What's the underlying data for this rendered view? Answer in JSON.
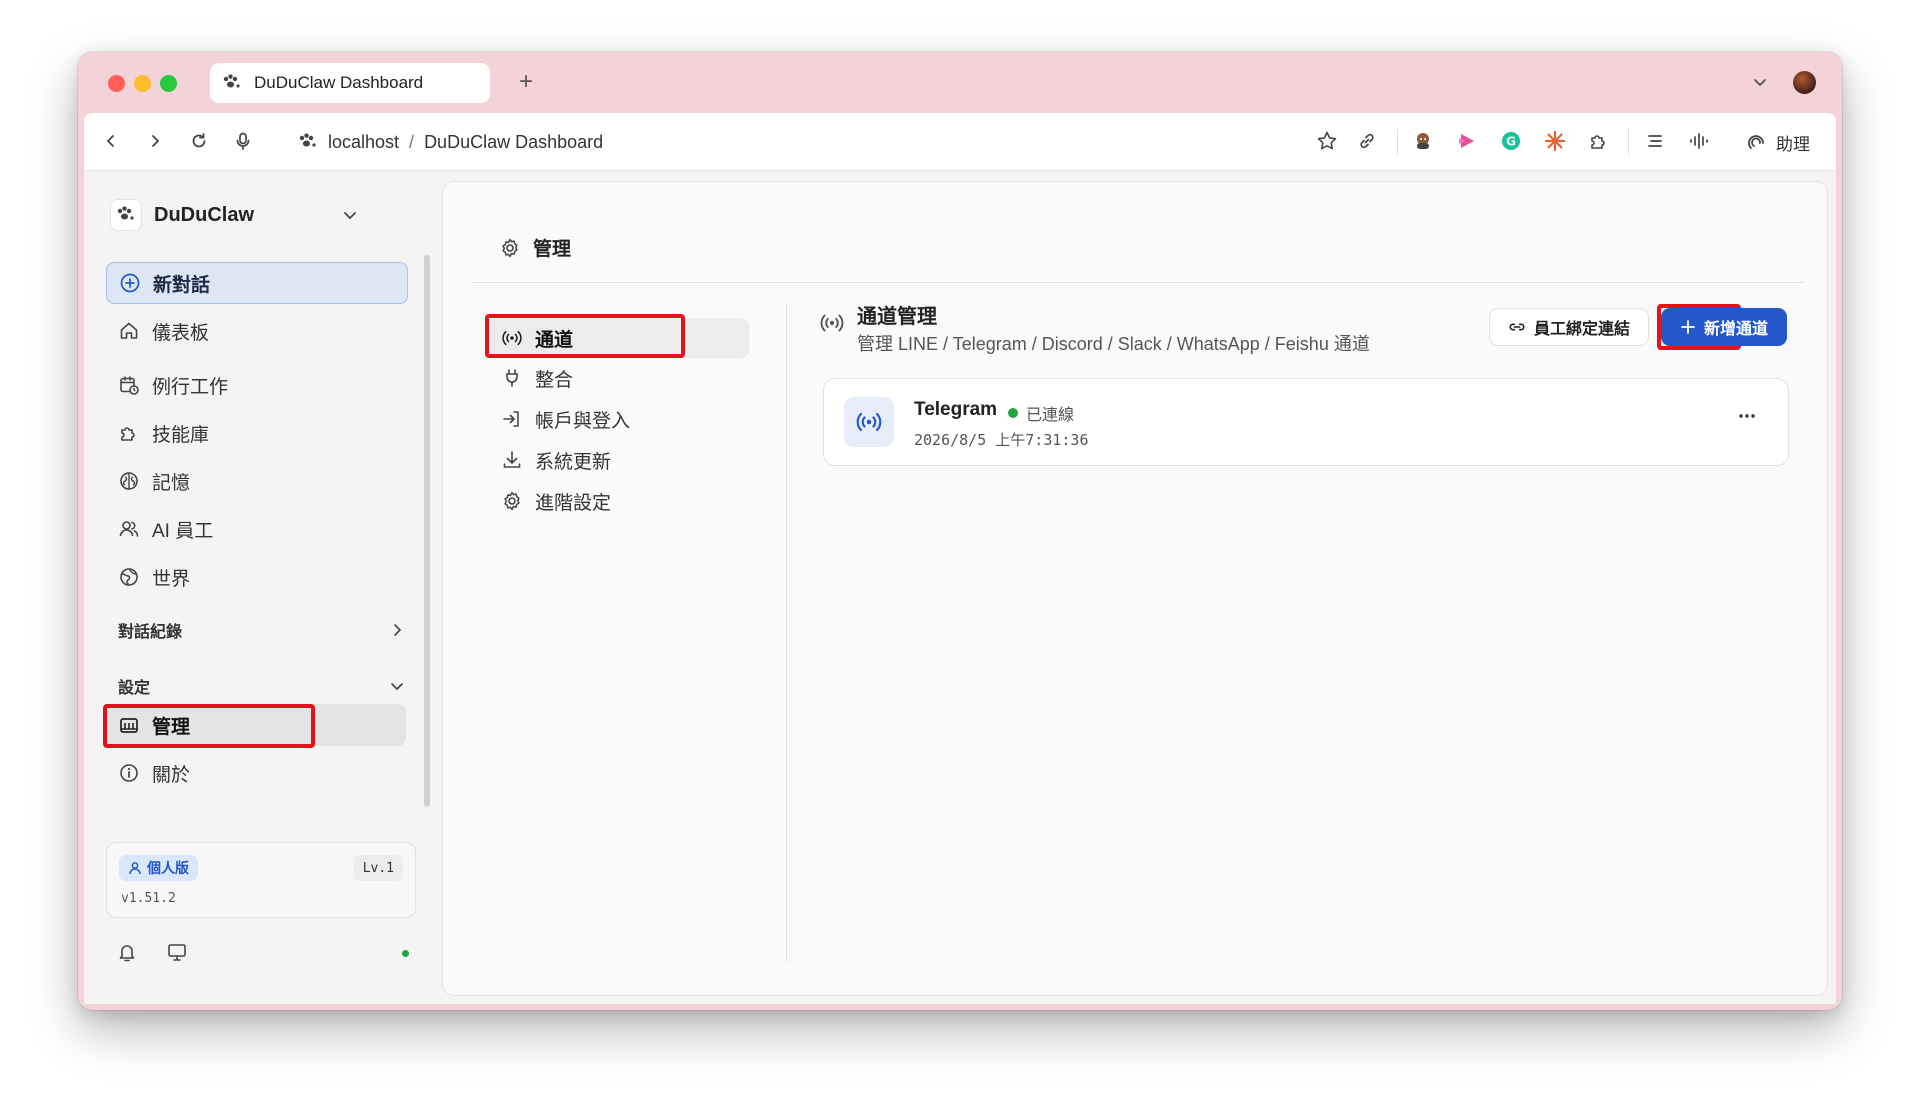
{
  "browser": {
    "tab_title": "DuDuClaw Dashboard",
    "url_host": "localhost",
    "url_separator": "/",
    "url_page": "DuDuClaw Dashboard",
    "assistant_label": "助理"
  },
  "sidebar": {
    "brand": "DuDuClaw",
    "new_chat": "新對話",
    "items": [
      {
        "label": "儀表板"
      },
      {
        "label": "例行工作"
      },
      {
        "label": "技能庫"
      },
      {
        "label": "記憶"
      },
      {
        "label": "AI 員工"
      },
      {
        "label": "世界"
      }
    ],
    "section_history": "對話紀錄",
    "section_settings": "設定",
    "settings_items": [
      {
        "label": "管理"
      },
      {
        "label": "關於"
      }
    ],
    "plan_badge": "個人版",
    "level": "Lv.1",
    "version": "v1.51.2"
  },
  "main": {
    "header": "管理",
    "subnav": [
      {
        "label": "通道"
      },
      {
        "label": "整合"
      },
      {
        "label": "帳戶與登入"
      },
      {
        "label": "系統更新"
      },
      {
        "label": "進階設定"
      }
    ],
    "panel_title": "通道管理",
    "panel_subtitle": "管理 LINE / Telegram / Discord / Slack / WhatsApp / Feishu 通道",
    "bind_button": "員工綁定連結",
    "add_button": "新增通道",
    "channels": [
      {
        "name": "Telegram",
        "status": "已連線",
        "time": "2026/8/5 上午7:31:36"
      }
    ]
  },
  "colors": {
    "accent": "#2457c9",
    "highlight": "#e3121b",
    "connected": "#22a447"
  }
}
